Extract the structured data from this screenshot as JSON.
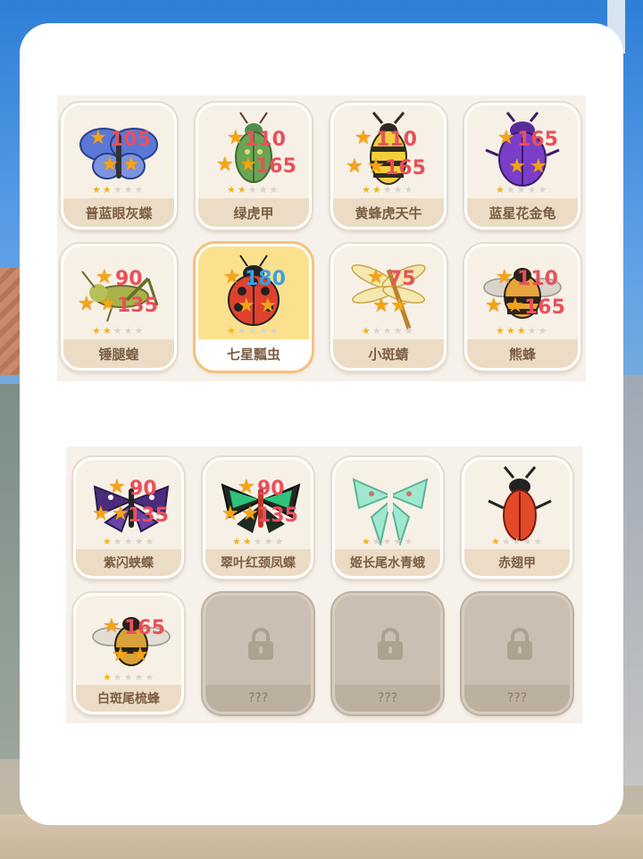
{
  "page": {
    "colors": {
      "score_red": "#e8505b",
      "star_gold": "#f4a418",
      "tile_bg": "#f7f0e6",
      "selected_bg": "#fbe18e",
      "locked_bg": "#c9bfb2"
    }
  },
  "grid1": {
    "items": [
      {
        "name": "普蓝眼灰蝶",
        "rarity": 2,
        "score1": "105",
        "icon": "blue-butterfly-icon"
      },
      {
        "name": "绿虎甲",
        "rarity": 2,
        "score1": "110",
        "score2": "165",
        "icon": "green-beetle-icon"
      },
      {
        "name": "黄蜂虎天牛",
        "rarity": 2,
        "score1": "110",
        "score2": "165",
        "icon": "yellow-longhorn-icon"
      },
      {
        "name": "蓝星花金龟",
        "rarity": 1,
        "score1": "165",
        "icon": "purple-beetle-icon"
      },
      {
        "name": "锤腿蝗",
        "rarity": 2,
        "score1": "90",
        "score2": "135",
        "icon": "grasshopper-icon"
      },
      {
        "name": "七星瓢虫",
        "rarity": 1,
        "score1": "180",
        "icon": "ladybug-icon",
        "selected": true
      },
      {
        "name": "小斑蜻",
        "rarity": 1,
        "score1": "75",
        "icon": "dragonfly-icon"
      },
      {
        "name": "熊蜂",
        "rarity": 3,
        "score1": "110",
        "score2": "165",
        "icon": "bumblebee-icon"
      }
    ]
  },
  "grid2": {
    "items": [
      {
        "name": "紫闪蛱蝶",
        "rarity": 1,
        "score1": "90",
        "score2": "135",
        "icon": "purple-butterfly-icon"
      },
      {
        "name": "翠叶红颈凤蝶",
        "rarity": 2,
        "score1": "90",
        "score2": "135",
        "icon": "green-swallowtail-icon"
      },
      {
        "name": "姬长尾水青蛾",
        "rarity": 1,
        "icon": "luna-moth-icon"
      },
      {
        "name": "赤翅甲",
        "rarity": 1,
        "icon": "red-beetle-icon"
      },
      {
        "name": "白斑尾梳蜂",
        "rarity": 1,
        "score1": "165",
        "icon": "white-bee-icon"
      },
      {
        "name": "???",
        "locked": true,
        "icon": "lock-icon"
      },
      {
        "name": "???",
        "locked": true,
        "icon": "lock-icon"
      },
      {
        "name": "???",
        "locked": true,
        "icon": "lock-icon"
      }
    ]
  }
}
